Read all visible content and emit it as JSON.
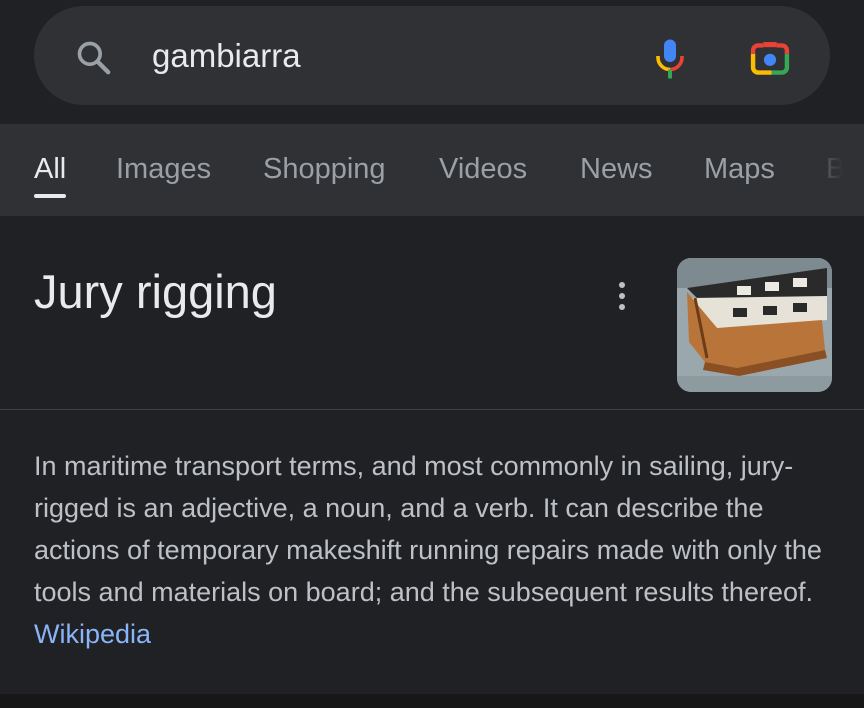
{
  "search": {
    "query": "gambiarra"
  },
  "tabs": [
    {
      "label": "All"
    },
    {
      "label": "Images"
    },
    {
      "label": "Shopping"
    },
    {
      "label": "Videos"
    },
    {
      "label": "News"
    },
    {
      "label": "Maps"
    },
    {
      "label": "Bo"
    }
  ],
  "panel": {
    "title": "Jury rigging",
    "description": "In maritime transport terms, and most commonly in sailing, jury-rigged is an adjective, a noun, and a verb. It can describe the actions of temporary makeshift running repairs made with only the tools and materials on board; and the subsequent results thereof.",
    "source_label": "Wikipedia"
  },
  "icons": {
    "search": "search-icon",
    "mic": "microphone-icon",
    "lens": "lens-camera-icon",
    "more": "more-vert-icon"
  },
  "colors": {
    "background": "#202124",
    "surface": "#303134",
    "text_primary": "#e8eaed",
    "text_secondary": "#9aa0a6",
    "link": "#8ab4f8"
  }
}
